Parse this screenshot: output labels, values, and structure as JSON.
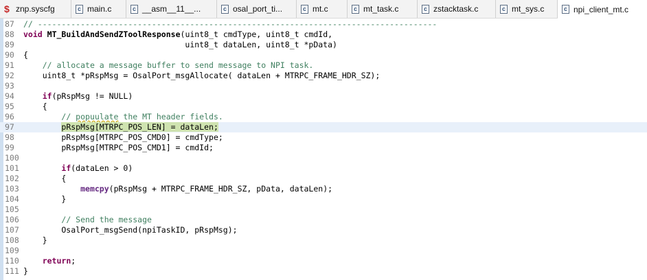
{
  "tabs": [
    {
      "label": "znp.syscfg",
      "icon": "syscfg-file-icon"
    },
    {
      "label": "main.c",
      "icon": "c-file-icon"
    },
    {
      "label": "__asm__11__...",
      "icon": "c-file-icon"
    },
    {
      "label": "osal_port_ti...",
      "icon": "c-file-icon"
    },
    {
      "label": "mt.c",
      "icon": "c-file-icon"
    },
    {
      "label": "mt_task.c",
      "icon": "c-file-icon"
    },
    {
      "label": "zstacktask.c",
      "icon": "c-file-icon"
    },
    {
      "label": "mt_sys.c",
      "icon": "c-file-icon"
    },
    {
      "label": "npi_client_mt.c",
      "icon": "c-file-icon"
    }
  ],
  "tab_icon_letter": "c",
  "lines": [
    {
      "n": "87",
      "t": "// ------------------------------------------------------------------------------------"
    },
    {
      "n": "88",
      "t": "void MT_BuildAndSendZToolResponse(uint8_t cmdType, uint8_t cmdId,"
    },
    {
      "n": "89",
      "t": "                                  uint8_t dataLen, uint8_t *pData)"
    },
    {
      "n": "90",
      "t": "{"
    },
    {
      "n": "91",
      "t": "    // allocate a message buffer to send message to NPI task."
    },
    {
      "n": "92",
      "t": "    uint8_t *pRspMsg = OsalPort_msgAllocate( dataLen + MTRPC_FRAME_HDR_SZ);"
    },
    {
      "n": "93",
      "t": ""
    },
    {
      "n": "94",
      "t": "    if(pRspMsg != NULL)"
    },
    {
      "n": "95",
      "t": "    {"
    },
    {
      "n": "96",
      "t": "        // popuulate the MT header fields."
    },
    {
      "n": "97",
      "t": "        pRspMsg[MTRPC_POS_LEN] = dataLen;"
    },
    {
      "n": "98",
      "t": "        pRspMsg[MTRPC_POS_CMD0] = cmdType;"
    },
    {
      "n": "99",
      "t": "        pRspMsg[MTRPC_POS_CMD1] = cmdId;"
    },
    {
      "n": "100",
      "t": ""
    },
    {
      "n": "101",
      "t": "        if(dataLen > 0)"
    },
    {
      "n": "102",
      "t": "        {"
    },
    {
      "n": "103",
      "t": "            memcpy(pRspMsg + MTRPC_FRAME_HDR_SZ, pData, dataLen);"
    },
    {
      "n": "104",
      "t": "        }"
    },
    {
      "n": "105",
      "t": ""
    },
    {
      "n": "106",
      "t": "        // Send the message"
    },
    {
      "n": "107",
      "t": "        OsalPort_msgSend(npiTaskID, pRspMsg);"
    },
    {
      "n": "108",
      "t": "    }"
    },
    {
      "n": "109",
      "t": ""
    },
    {
      "n": "110",
      "t": "    return;"
    },
    {
      "n": "111",
      "t": "}"
    }
  ],
  "highlighted_line": "97",
  "colors": {
    "keyword": "#7f0055",
    "comment": "#3f7f5f",
    "line_highlight": "#e8f0fa"
  }
}
